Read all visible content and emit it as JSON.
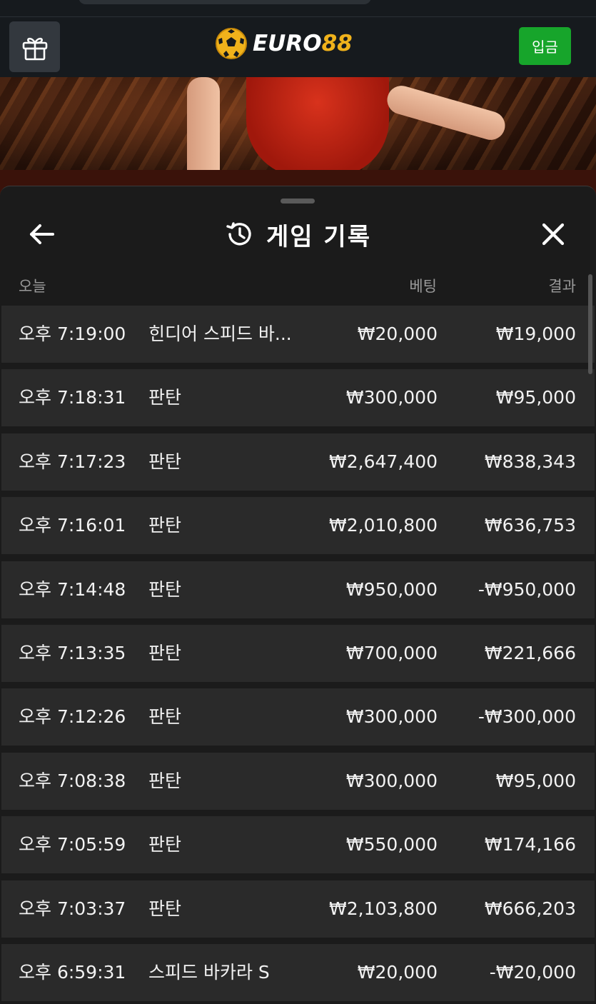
{
  "header": {
    "logo_text_white": "EURO",
    "logo_text_yellow": "88",
    "deposit_label": "입금",
    "icons": {
      "gift": "gift-icon",
      "logo": "soccer-ball-icon"
    }
  },
  "sheet": {
    "title": "게임 기록",
    "icons": {
      "back": "arrow-left-icon",
      "history": "history-icon",
      "close": "close-icon"
    },
    "columns": {
      "date": "오늘",
      "bet": "베팅",
      "result": "결과"
    },
    "rows": [
      {
        "time": "오후 7:19:00",
        "game": "힌디어 스피드 바...",
        "bet": "₩20,000",
        "result": "₩19,000"
      },
      {
        "time": "오후 7:18:31",
        "game": "판탄",
        "bet": "₩300,000",
        "result": "₩95,000"
      },
      {
        "time": "오후 7:17:23",
        "game": "판탄",
        "bet": "₩2,647,400",
        "result": "₩838,343"
      },
      {
        "time": "오후 7:16:01",
        "game": "판탄",
        "bet": "₩2,010,800",
        "result": "₩636,753"
      },
      {
        "time": "오후 7:14:48",
        "game": "판탄",
        "bet": "₩950,000",
        "result": "-₩950,000"
      },
      {
        "time": "오후 7:13:35",
        "game": "판탄",
        "bet": "₩700,000",
        "result": "₩221,666"
      },
      {
        "time": "오후 7:12:26",
        "game": "판탄",
        "bet": "₩300,000",
        "result": "-₩300,000"
      },
      {
        "time": "오후 7:08:38",
        "game": "판탄",
        "bet": "₩300,000",
        "result": "₩95,000"
      },
      {
        "time": "오후 7:05:59",
        "game": "판탄",
        "bet": "₩550,000",
        "result": "₩174,166"
      },
      {
        "time": "오후 7:03:37",
        "game": "판탄",
        "bet": "₩2,103,800",
        "result": "₩666,203"
      },
      {
        "time": "오후 6:59:31",
        "game": "스피드 바카라 S",
        "bet": "₩20,000",
        "result": "-₩20,000"
      }
    ]
  },
  "colors": {
    "accent_green": "#17a52b",
    "logo_yellow": "#f0b21b",
    "row_bg": "#2a2a2a",
    "sheet_bg": "#1b1b1b"
  }
}
